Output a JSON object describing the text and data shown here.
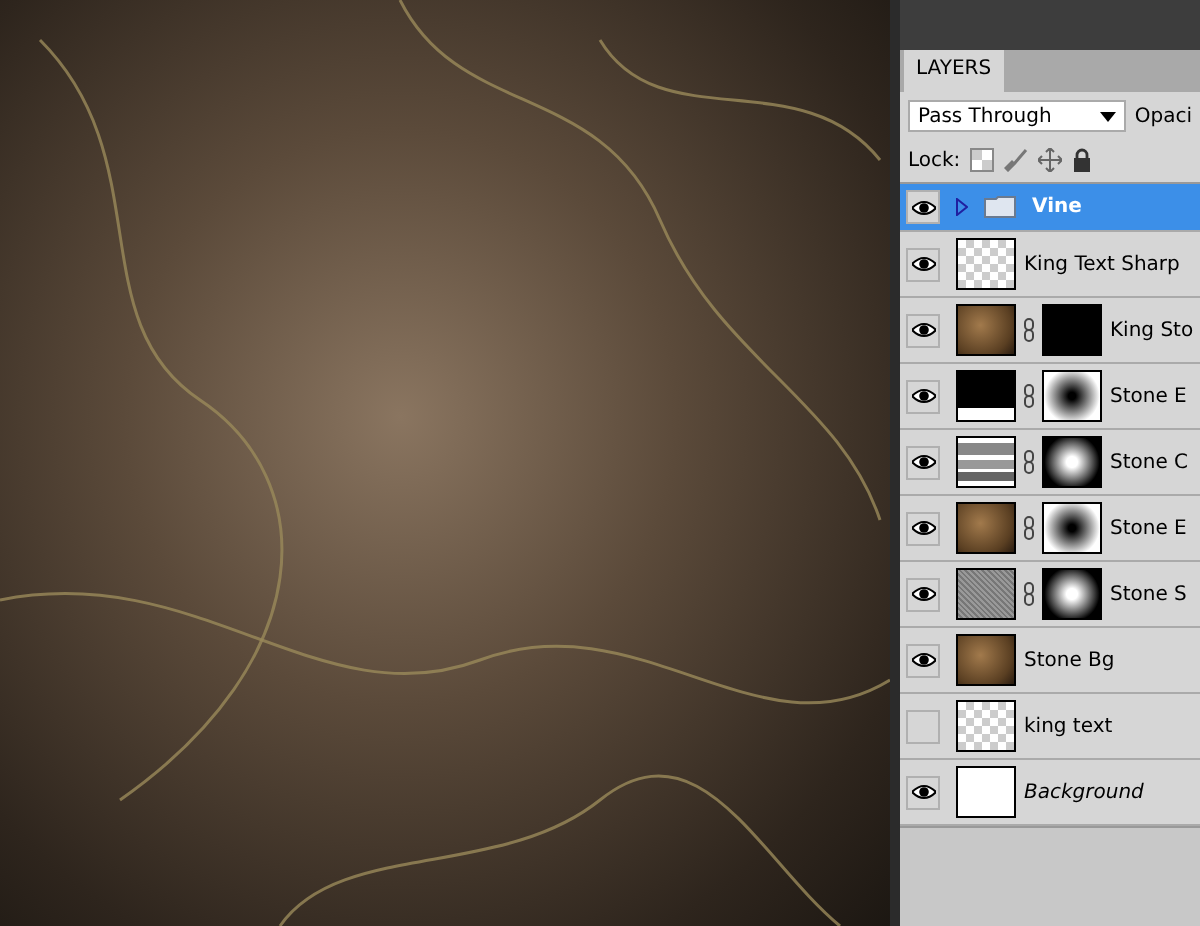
{
  "layers_panel": {
    "tab": "LAYERS",
    "blend_mode": "Pass Through",
    "opacity_label": "Opaci",
    "lock_label": "Lock:",
    "layers": [
      {
        "kind": "group",
        "name": "Vine",
        "visible": true,
        "selected": true
      },
      {
        "kind": "layer",
        "name": "King Text Sharp",
        "thumbnail": {
          "kind": "transparent"
        },
        "visible": true,
        "selected": false
      },
      {
        "kind": "layer",
        "name": "King Sto",
        "thumbnail": {
          "kind": "texture"
        },
        "mask": {
          "kind": "text"
        },
        "visible": true,
        "selected": false
      },
      {
        "kind": "layer",
        "name": "Stone E",
        "thumbnail": {
          "kind": "levels"
        },
        "mask": {
          "kind": "dark"
        },
        "visible": true,
        "selected": false
      },
      {
        "kind": "layer",
        "name": "Stone C",
        "thumbnail": {
          "kind": "curves"
        },
        "mask": {
          "kind": "light"
        },
        "visible": true,
        "selected": false
      },
      {
        "kind": "layer",
        "name": "Stone E",
        "thumbnail": {
          "kind": "texture"
        },
        "mask": {
          "kind": "dark"
        },
        "visible": true,
        "selected": false
      },
      {
        "kind": "layer",
        "name": "Stone S",
        "thumbnail": {
          "kind": "noise"
        },
        "mask": {
          "kind": "light"
        },
        "visible": true,
        "selected": false
      },
      {
        "kind": "layer",
        "name": "Stone Bg",
        "thumbnail": {
          "kind": "texture"
        },
        "visible": true,
        "selected": false
      },
      {
        "kind": "layer",
        "name": "king text",
        "thumbnail": {
          "kind": "transparent"
        },
        "visible": false,
        "selected": false
      },
      {
        "kind": "background",
        "name": "Background",
        "thumbnail": {
          "kind": "white"
        },
        "visible": true,
        "selected": false
      }
    ]
  }
}
